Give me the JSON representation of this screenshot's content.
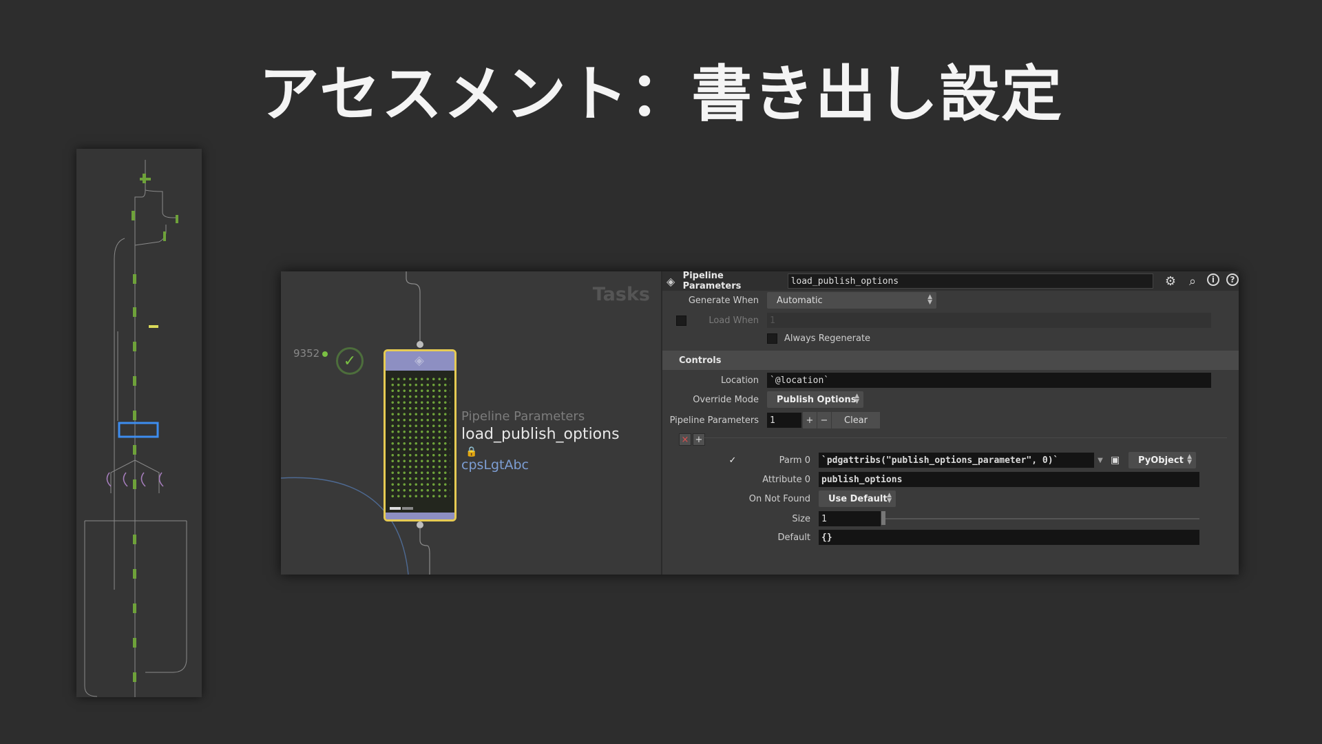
{
  "slide": {
    "title": "アセスメント：書き出し設定"
  },
  "network": {
    "tasks_label": "Tasks",
    "work_item_count": "9352",
    "node_type": "Pipeline Parameters",
    "node_name": "load_publish_options",
    "node_comment": "cpsLgtAbc"
  },
  "params": {
    "header": {
      "type_name": "Pipeline Parameters",
      "node_name": "load_publish_options"
    },
    "generate_when": {
      "label": "Generate When",
      "value": "Automatic"
    },
    "load_when": {
      "label": "Load When",
      "value": "1"
    },
    "always_regenerate": {
      "label": "Always Regenerate"
    },
    "controls_section": "Controls",
    "location": {
      "label": "Location",
      "value": "`@location`"
    },
    "override_mode": {
      "label": "Override Mode",
      "value": "Publish Options"
    },
    "pipeline_parameters": {
      "label": "Pipeline Parameters",
      "value": "1",
      "clear_label": "Clear"
    },
    "parm0": {
      "label": "Parm 0",
      "value": "`pdgattribs(\"publish_options_parameter\", 0)`",
      "type": "PyObject"
    },
    "attribute0": {
      "label": "Attribute 0",
      "value": "publish_options"
    },
    "on_not_found": {
      "label": "On Not Found",
      "value": "Use Default"
    },
    "size": {
      "label": "Size",
      "value": "1"
    },
    "default": {
      "label": "Default",
      "value": "{}"
    }
  },
  "colors": {
    "background": "#2d2d2d",
    "node_border": "#e6cb53",
    "node_header": "#8d8fc2",
    "work_item_green": "#6ea23a",
    "comment_blue": "#7d9ed4"
  }
}
